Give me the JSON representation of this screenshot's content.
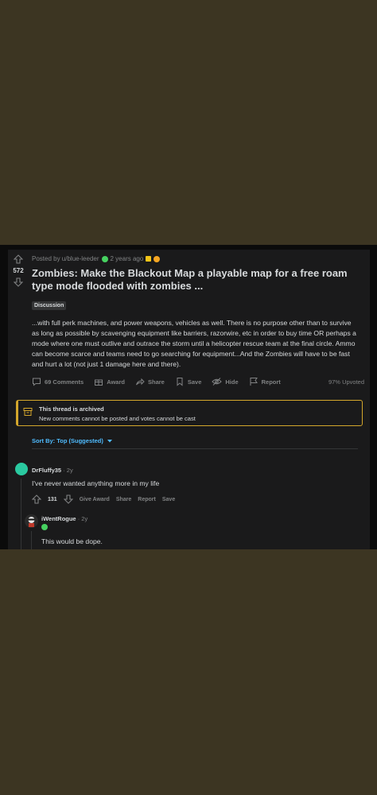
{
  "post": {
    "score": "572",
    "author_line": "Posted by u/blue-leeder",
    "age": "2 years ago",
    "title": "Zombies: Make the Blackout Map a playable map for a free roam type mode flooded with zombies ...",
    "flair": "Discussion",
    "body": "...with full perk machines, and power weapons, vehicles as well. There is no purpose other than to survive as long as possible by scavenging equipment like barriers, razorwire, etc in order to buy time OR perhaps a mode where one must outlive and outrace the storm until a helicopter rescue team at the final circle. Ammo can become scarce and teams need to go searching for equipment...And the Zombies will have to be fast and hurt a lot (not just 1 damage here and there).",
    "actions": {
      "comments": "69 Comments",
      "award": "Award",
      "share": "Share",
      "save": "Save",
      "hide": "Hide",
      "report": "Report"
    },
    "upvoted": "97% Upvoted"
  },
  "archive": {
    "title": "This thread is archived",
    "subtitle": "New comments cannot be posted and votes cannot be cast"
  },
  "sort": {
    "label": "Sort By: Top (Suggested)"
  },
  "comments": [
    {
      "author": "DrFluffy35",
      "age": "· 2y",
      "text": "I've never wanted anything more in my life",
      "score": "131",
      "actions": [
        "Give Award",
        "Share",
        "Report",
        "Save"
      ]
    },
    {
      "author": "iWentRogue",
      "age": "· 2y",
      "text": "This would be dope."
    }
  ],
  "colors": {
    "background": "#3c3522",
    "card": "#1a1a1b",
    "accent_blue": "#4fbcff",
    "archive_border": "#d4a72c",
    "text": "#d7dadc",
    "muted": "#818384"
  }
}
